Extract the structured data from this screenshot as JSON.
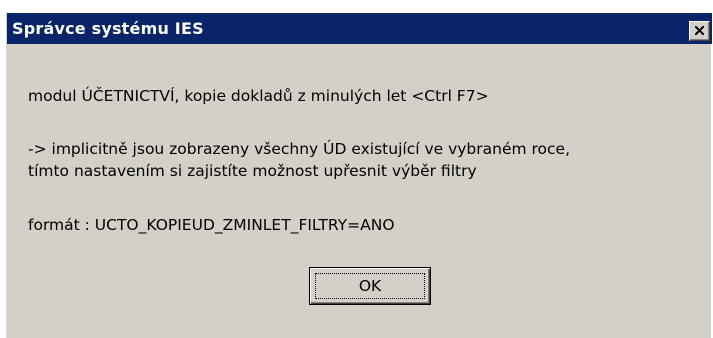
{
  "window": {
    "title": "Správce systému IES",
    "close_icon": "close-icon"
  },
  "message": {
    "line1": "modul ÚČETNICTVÍ, kopie dokladů z minulých let <Ctrl F7>",
    "line2": "-> implicitně jsou zobrazeny všechny ÚD existující ve vybraném roce,",
    "line3": "tímto nastavením si zajistíte možnost upřesnit výběr filtry",
    "line4": "formát : UCTO_KOPIEUD_ZMINLET_FILTRY=ANO"
  },
  "buttons": {
    "ok_label": "OK"
  },
  "colors": {
    "titlebar": "#0a246a",
    "dialog_bg": "#d4d0c8"
  }
}
